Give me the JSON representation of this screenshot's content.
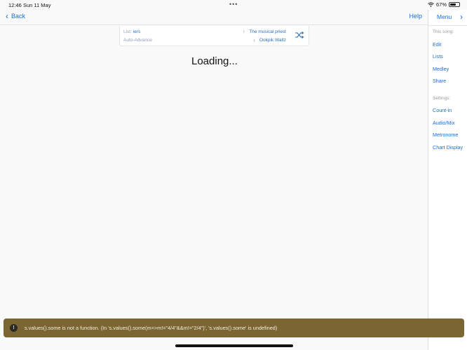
{
  "status_bar": {
    "time": "12:46",
    "date": "Sun 11 May",
    "battery_text": "67%",
    "battery_level": 0.67
  },
  "header": {
    "back_label": "Back",
    "help_label": "Help"
  },
  "list_card": {
    "list_prefix": "List:",
    "list_name": "iers",
    "auto_advance": "Auto-Advance",
    "prev_song": "The musical priest",
    "next_song": "Ookpik Waltz"
  },
  "loading_text": "Loading...",
  "sidebar": {
    "menu_label": "Menu",
    "this_song_label": "This song:",
    "song_items": [
      "Edit",
      "Lists",
      "Medley",
      "Share"
    ],
    "settings_label": "Settings:",
    "settings_items": [
      "Count-in",
      "Audio/Mix",
      "Metronome",
      "Chart Display"
    ]
  },
  "error": {
    "message": "s.values().some is not a function. (In 's.values().some(m=>m!=\"4/4\"&&m!=\"2/4\")', 's.values().some' is undefined)"
  }
}
